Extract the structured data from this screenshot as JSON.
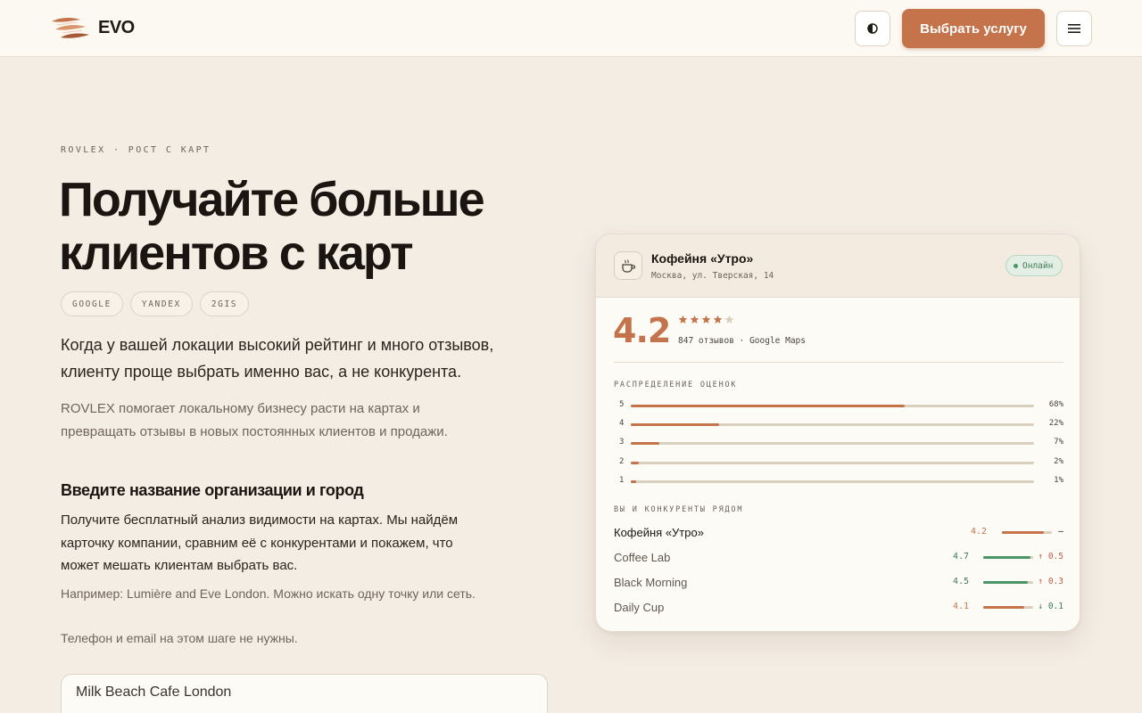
{
  "header": {
    "brand": "EVO",
    "cta_label": "Выбрать услугу",
    "theme_icon": "half-circle-icon",
    "menu_icon": "hamburger-icon"
  },
  "hero": {
    "eyebrow": "ROVLEX · РОСТ С КАРТ",
    "title_line1": "Получайте больше",
    "title_line2": "клиентов с карт",
    "chips": [
      "GOOGLE",
      "YANDEX",
      "2GIS"
    ],
    "lead": "Когда у вашей локации высокий рейтинг и много отзывов, клиенту проще выбрать именно вас, а не конкурента.",
    "sub": "ROVLEX помогает локальному бизнесу расти на картах и превращать отзывы в новых постоянных клиентов и продажи."
  },
  "form": {
    "title": "Введите название организации и город",
    "description": "Получите бесплатный анализ видимости на картах. Мы найдём карточку компании, сравним её с конкурентами и покажем, что может мешать клиентам выбрать вас.",
    "example": "Например: Lumière and Eve London. Можно искать одну точку или сеть.",
    "note": "Телефон и email на этом шаге не нужны.",
    "input_value": "Milk Beach Cafe London"
  },
  "card": {
    "business_name": "Кофейня «Утро»",
    "address": "Москва, ул. Тверская, 14",
    "status": "Онлайн",
    "rating": "4.2",
    "stars_filled": 4,
    "stars_total": 5,
    "reviews_meta": "847 отзывов · Google Maps",
    "distribution_label": "РАСПРЕДЕЛЕНИЕ ОЦЕНОК",
    "distribution": [
      {
        "star": "5",
        "percent": 68,
        "label": "68%"
      },
      {
        "star": "4",
        "percent": 22,
        "label": "22%"
      },
      {
        "star": "3",
        "percent": 7,
        "label": "7%"
      },
      {
        "star": "2",
        "percent": 2,
        "label": "2%"
      },
      {
        "star": "1",
        "percent": 1,
        "label": "1%"
      }
    ],
    "competitors_label": "ВЫ И КОНКУРЕНТЫ РЯДОМ",
    "competitors": [
      {
        "name": "Кофейня «Утро»",
        "rating": "4.2",
        "value": 4.2,
        "delta": "—",
        "self": true
      },
      {
        "name": "Coffee Lab",
        "rating": "4.7",
        "value": 4.7,
        "delta": "↑ 0.5",
        "lower": false
      },
      {
        "name": "Black Morning",
        "rating": "4.5",
        "value": 4.5,
        "delta": "↑ 0.3",
        "lower": false
      },
      {
        "name": "Daily Cup",
        "rating": "4.1",
        "value": 4.1,
        "delta": "↓ 0.1",
        "lower": true
      }
    ]
  },
  "colors": {
    "accent": "#c4734b",
    "positive": "#4a9466",
    "negative": "#c05b4a",
    "background": "#f4ede4"
  }
}
